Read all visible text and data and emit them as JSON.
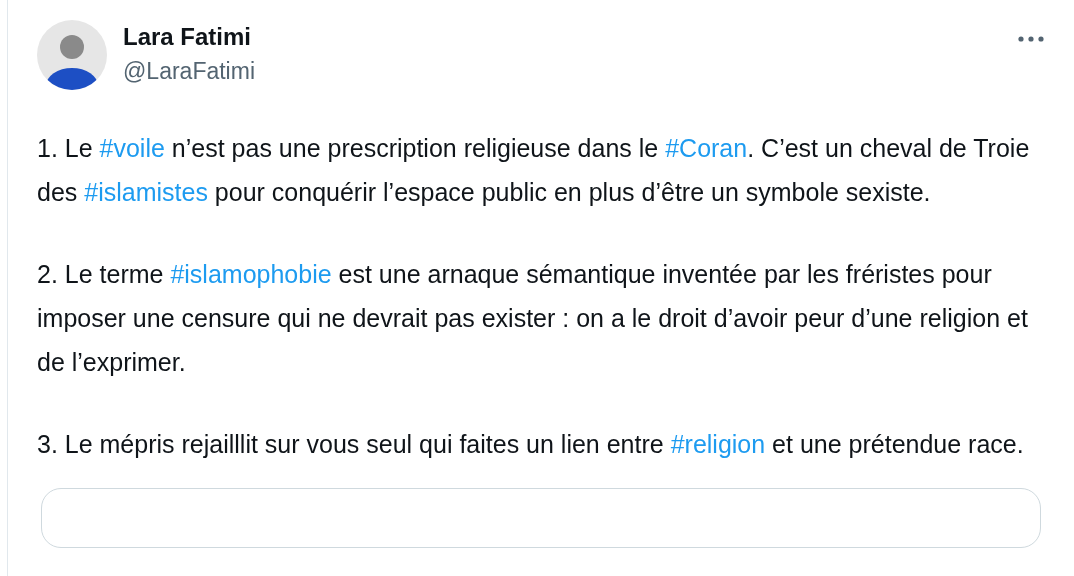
{
  "author": {
    "name": "Lara Fatimi",
    "handle": "@LaraFatimi"
  },
  "paragraphs": [
    [
      {
        "kind": "text",
        "text": "1. Le "
      },
      {
        "kind": "hashtag",
        "text": "#voile"
      },
      {
        "kind": "text",
        "text": " n’est pas une prescription religieuse dans le "
      },
      {
        "kind": "hashtag",
        "text": "#Coran"
      },
      {
        "kind": "text",
        "text": ". C’est un cheval de Troie des "
      },
      {
        "kind": "hashtag",
        "text": "#islamistes"
      },
      {
        "kind": "text",
        "text": " pour conquérir l’espace public en plus d’être un symbole sexiste."
      }
    ],
    [
      {
        "kind": "text",
        "text": "2. Le terme "
      },
      {
        "kind": "hashtag",
        "text": "#islamophobie"
      },
      {
        "kind": "text",
        "text": " est une arnaque sémantique inventée par les fréristes pour imposer une censure qui ne devrait pas exister : on a le droit d’avoir peur d’une religion et de l’exprimer."
      }
    ],
    [
      {
        "kind": "text",
        "text": "3. Le mépris rejailllit sur vous seul qui faites un lien entre "
      },
      {
        "kind": "hashtag",
        "text": "#religion"
      },
      {
        "kind": "text",
        "text": " et une prétendue race."
      }
    ]
  ]
}
